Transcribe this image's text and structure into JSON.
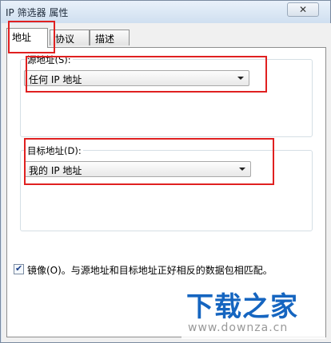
{
  "window": {
    "title": "IP 筛选器 属性",
    "close_symbol": "✕"
  },
  "tabs": [
    {
      "label": "地址",
      "active": true
    },
    {
      "label": "协议",
      "active": false
    },
    {
      "label": "描述",
      "active": false
    }
  ],
  "source": {
    "label": "源地址(S):",
    "selected": "任何 IP 地址"
  },
  "destination": {
    "label": "目标地址(D):",
    "selected": "我的 IP 地址"
  },
  "mirror": {
    "checked": true,
    "label": "镜像(O)。与源地址和目标地址正好相反的数据包相匹配。"
  },
  "watermark": {
    "brand": "下载之家",
    "url": "www.downza.cn"
  },
  "colors": {
    "highlight": "#e02020",
    "watermark_blue": "#1565c0"
  }
}
